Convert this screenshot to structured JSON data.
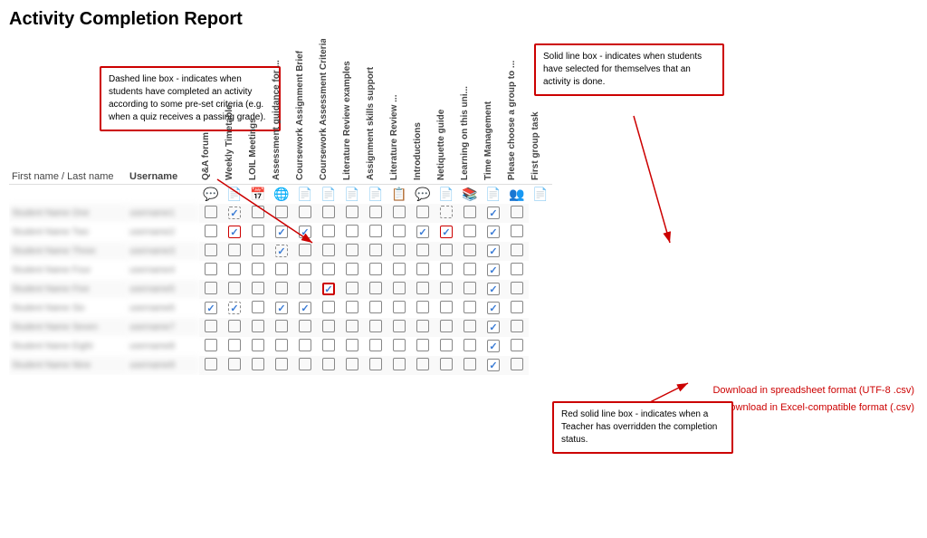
{
  "page": {
    "title": "Activity Completion Report"
  },
  "annotations": {
    "dashed_box": {
      "text": "Dashed line box - indicates when students have completed an activity according to some pre-set criteria (e.g. when a quiz receives a passing grade)."
    },
    "solid_box": {
      "text": "Solid line box - indicates when students have selected for themselves that an activity is done."
    },
    "red_solid_box": {
      "text": "Red solid line box - indicates when a Teacher has overridden the completion status."
    }
  },
  "header": {
    "name_label": "First name / Last name",
    "username_label": "Username"
  },
  "columns": [
    "Q&A forum",
    "Weekly Timetable",
    "LOIL Meetings",
    "Assessment guidance for ...",
    "Coursework Assignment Brief",
    "Coursework Assessment Criteria",
    "Literature Review examples",
    "Assignment skills support",
    "Literature Review ...",
    "Introductions",
    "Netiquette guide",
    "Learning on this uni...",
    "Time Management",
    "Please choose a group to ...",
    "First group task"
  ],
  "download": {
    "csv_utf8": "Download in spreadsheet format (UTF-8 .csv)",
    "csv_excel": "Download in Excel-compatible format (.csv)"
  }
}
